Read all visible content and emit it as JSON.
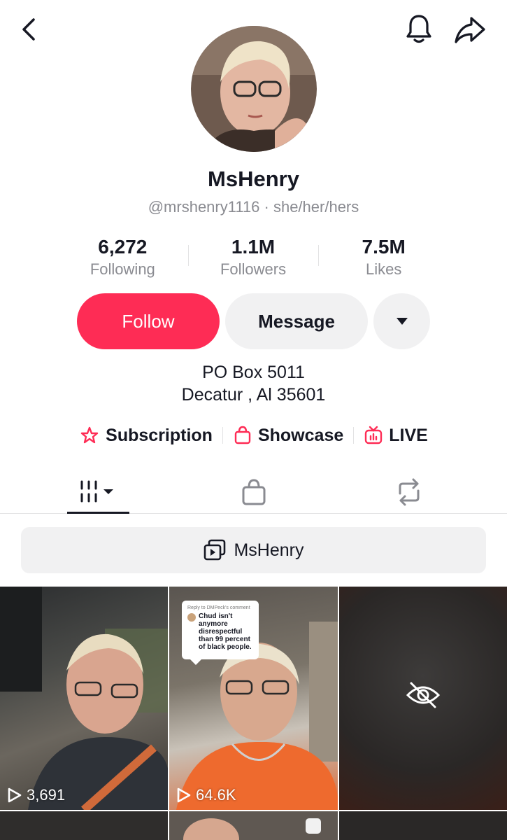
{
  "profile": {
    "display_name": "MsHenry",
    "handle_line": "@mrshenry1116 · she/her/hers",
    "bio_line1": "PO Box 5011",
    "bio_line2": "Decatur , Al 35601"
  },
  "stats": [
    {
      "value": "6,272",
      "label": "Following"
    },
    {
      "value": "1.1M",
      "label": "Followers"
    },
    {
      "value": "7.5M",
      "label": "Likes"
    }
  ],
  "actions": {
    "follow_label": "Follow",
    "message_label": "Message"
  },
  "links": {
    "subscription": "Subscription",
    "showcase": "Showcase",
    "live": "LIVE"
  },
  "playlist_label": "MsHenry",
  "videos": [
    {
      "views": "3,691"
    },
    {
      "views": "64.6K",
      "reply_header": "Reply to DMPeck's comment",
      "reply_text": "Chud isn't anymore disrespectful than 99 percent of black people."
    },
    {
      "hidden": true
    }
  ],
  "colors": {
    "accent": "#fe2c55",
    "text": "#161823",
    "muted": "#8a8b91",
    "button_bg": "#f1f1f2"
  }
}
